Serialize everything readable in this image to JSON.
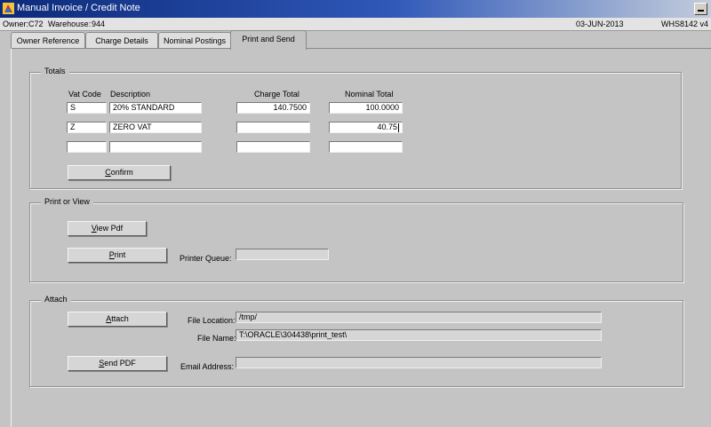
{
  "window": {
    "title": "Manual Invoice / Credit Note"
  },
  "infobar": {
    "owner_label": "Owner:",
    "owner": "C72",
    "warehouse_label": "Warehouse:",
    "warehouse": "944",
    "date": "03-JUN-2013",
    "version": "WHS8142 v4"
  },
  "tabs": [
    {
      "label": "Owner Reference"
    },
    {
      "label": "Charge Details"
    },
    {
      "label": "Nominal Postings"
    },
    {
      "label": "Print and Send"
    }
  ],
  "totals": {
    "legend": "Totals",
    "headers": {
      "vat_code": "Vat Code",
      "description": "Description",
      "charge_total": "Charge Total",
      "nominal_total": "Nominal Total"
    },
    "rows": [
      {
        "vat_code": "S",
        "description": "20% STANDARD",
        "charge_total": "140.7500",
        "nominal_total": "100.0000"
      },
      {
        "vat_code": "Z",
        "description": "ZERO VAT",
        "charge_total": "",
        "nominal_total": "40.75"
      },
      {
        "vat_code": "",
        "description": "",
        "charge_total": "",
        "nominal_total": ""
      }
    ],
    "confirm": {
      "mnemonic": "C",
      "rest": "onfirm"
    }
  },
  "print_view": {
    "legend": "Print or View",
    "view_pdf": {
      "mnemonic": "V",
      "rest": "iew Pdf"
    },
    "print": {
      "mnemonic": "P",
      "rest": "rint"
    },
    "printer_queue_label": "Printer Queue:",
    "printer_queue": ""
  },
  "attach": {
    "legend": "Attach",
    "attach_button": {
      "mnemonic": "A",
      "rest": "ttach"
    },
    "file_location_label": "File Location:",
    "file_location": "/tmp/",
    "file_name_label": "File Name:",
    "file_name": "T:\\ORACLE\\304438\\print_test\\",
    "send_pdf": {
      "mnemonic": "S",
      "rest": "end PDF"
    },
    "email_label": "Email Address:",
    "email": ""
  }
}
